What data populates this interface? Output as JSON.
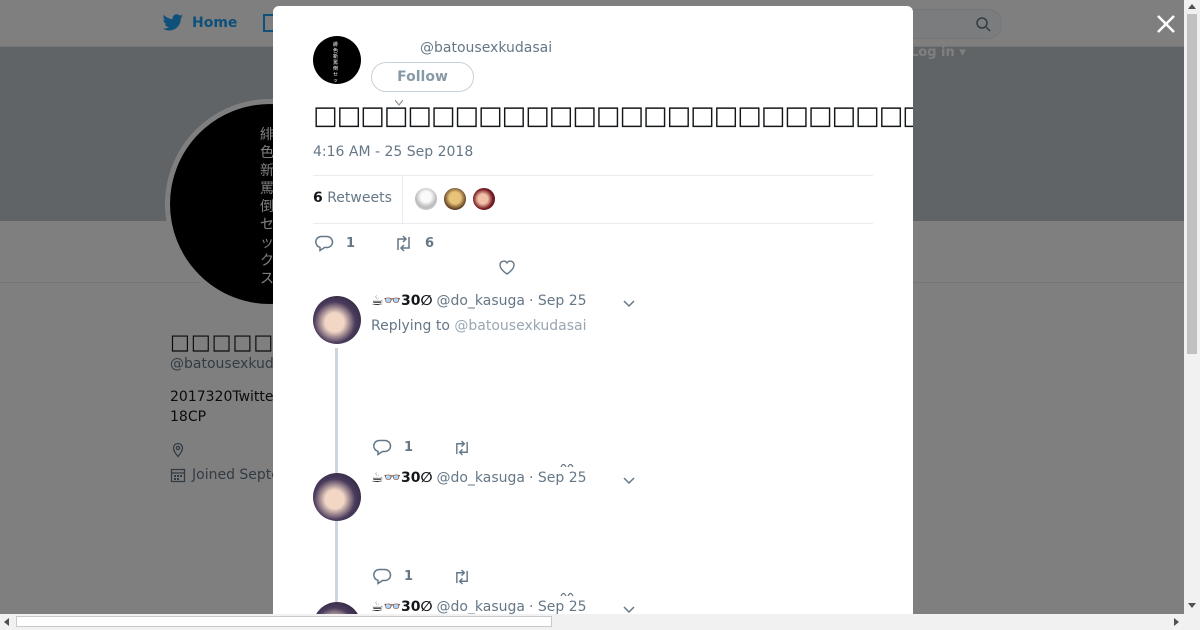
{
  "nav": {
    "home_label": "Home",
    "login_label": "Log in"
  },
  "background_profile": {
    "avatar_text": "緋色新罵倒セックス",
    "display_name": "□□□□□□□□□□□",
    "handle": "@batousexkud",
    "bio": "2017320Twitte 18CP",
    "joined": "Joined Septe"
  },
  "modal": {
    "handle": "@batousexkudasai",
    "follow_label": "Follow",
    "tweet_text": "□□□□□□□□□□□□□□□□□□□□□□□□□□□□□□□□□□□□□□□□□□□□□□□□□□□□□□□□□□□□□□□",
    "timestamp": "4:16 AM - 25 Sep 2018",
    "retweet_count": "6",
    "retweet_label": "Retweets",
    "reply_count": "1",
    "retweet_action_count": "6"
  },
  "replies": [
    {
      "name": "☕👓30∅",
      "username": "@do_kasuga",
      "date": "· Sep 25",
      "replying_prefix": "Replying to",
      "replying_to": "@batousexkudasai",
      "reply_count": "1"
    },
    {
      "name": "☕👓30∅",
      "username": "@do_kasuga",
      "date": "· Sep 25",
      "reply_count": "1"
    },
    {
      "name": "☕👓30∅",
      "username": "@do_kasuga",
      "date": "· Sep 25"
    }
  ],
  "colors": {
    "accent": "#1da1f2",
    "muted": "#657786",
    "overlay": "rgba(0,0,0,0.5)"
  },
  "icons": [
    "twitter-bird-icon",
    "moments-icon",
    "search-icon",
    "close-icon",
    "reply-icon",
    "retweet-icon",
    "like-icon",
    "chevron-down-icon",
    "location-icon",
    "calendar-icon"
  ]
}
